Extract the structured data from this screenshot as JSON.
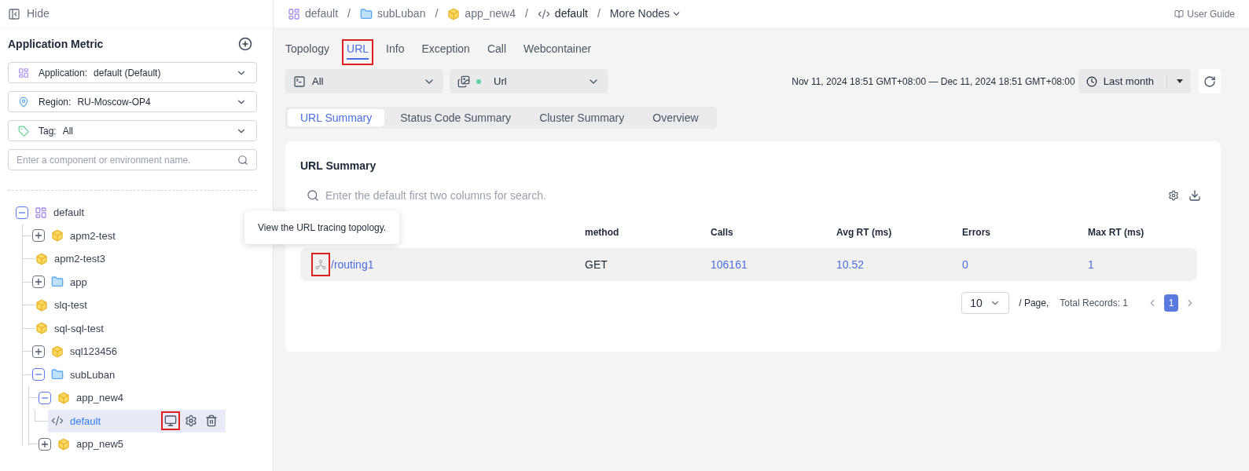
{
  "sidebar": {
    "hide_label": "Hide",
    "title": "Application Metric",
    "filters": [
      {
        "kind": "application",
        "label": "Application:",
        "value": "default (Default)"
      },
      {
        "kind": "region",
        "label": "Region:",
        "value": "RU-Moscow-OP4"
      },
      {
        "kind": "tag",
        "label": "Tag:",
        "value": "All"
      }
    ],
    "search": {
      "placeholder": "Enter a component or environment name."
    },
    "tree": [
      {
        "kind": "application",
        "label": "default",
        "expanded": true,
        "selected": false,
        "children": [
          {
            "kind": "component",
            "label": "apm2-test",
            "expanded": false,
            "selected": false
          },
          {
            "kind": "component",
            "label": "apm2-test3",
            "selected": false
          },
          {
            "kind": "folder",
            "label": "app",
            "expanded": false,
            "selected": false
          },
          {
            "kind": "component",
            "label": "slq-test",
            "selected": false
          },
          {
            "kind": "component",
            "label": "sql-sql-test",
            "selected": false
          },
          {
            "kind": "component",
            "label": "sql123456",
            "expanded": false,
            "selected": false
          },
          {
            "kind": "folder",
            "label": "subLuban",
            "expanded": true,
            "selected": false,
            "children": [
              {
                "kind": "component",
                "label": "app_new4",
                "expanded": true,
                "selected": false,
                "children": [
                  {
                    "kind": "environment",
                    "label": "default",
                    "selected": true,
                    "actions": [
                      {
                        "kind": "monitor",
                        "highlighted": true
                      },
                      {
                        "kind": "settings",
                        "highlighted": false
                      },
                      {
                        "kind": "delete",
                        "highlighted": false
                      }
                    ]
                  }
                ]
              },
              {
                "kind": "component",
                "label": "app_new5",
                "expanded": false,
                "selected": false
              }
            ]
          }
        ]
      }
    ]
  },
  "breadcrumbs": [
    {
      "kind": "application",
      "label": "default"
    },
    {
      "kind": "folder",
      "label": "subLuban"
    },
    {
      "kind": "component",
      "label": "app_new4"
    },
    {
      "kind": "environment",
      "label": "default"
    },
    {
      "kind": "more",
      "label": "More Nodes"
    }
  ],
  "breadcrumb_separator": "/",
  "user_guide": "User Guide",
  "tabs": [
    {
      "label": "Topology",
      "selected": false,
      "highlighted": false
    },
    {
      "label": "URL",
      "selected": true,
      "highlighted": true
    },
    {
      "label": "Info",
      "selected": false,
      "highlighted": false
    },
    {
      "label": "Exception",
      "selected": false,
      "highlighted": false
    },
    {
      "label": "Call",
      "selected": false,
      "highlighted": false
    },
    {
      "label": "Webcontainer",
      "selected": false,
      "highlighted": false
    }
  ],
  "selects": [
    {
      "kind": "terminal",
      "value": "All"
    },
    {
      "kind": "url",
      "value": "Url"
    }
  ],
  "time_range": {
    "text": "Nov 11, 2024 18:51 GMT+08:00 — Dec 11, 2024 18:51 GMT+08:00",
    "preset": "Last month"
  },
  "sub_tabs": [
    {
      "label": "URL Summary",
      "selected": true
    },
    {
      "label": "Status Code Summary",
      "selected": false
    },
    {
      "label": "Cluster Summary",
      "selected": false
    },
    {
      "label": "Overview",
      "selected": false
    }
  ],
  "card": {
    "title": "URL Summary",
    "search": {
      "placeholder": "Enter the default first two columns for search."
    },
    "columns": [
      "",
      "method",
      "Calls",
      "Avg RT (ms)",
      "Errors",
      "Max RT (ms)"
    ],
    "rows": [
      {
        "icon_highlighted": true,
        "cells": [
          "/routing1",
          "GET",
          "106161",
          "10.52",
          "0",
          "1"
        ]
      }
    ],
    "tooltip": "View the URL tracing topology.",
    "pagination": {
      "page_size": "10",
      "per_page": "/ Page,",
      "total": "Total Records: 1",
      "pages": [
        {
          "label": "1",
          "selected": true
        }
      ]
    }
  }
}
